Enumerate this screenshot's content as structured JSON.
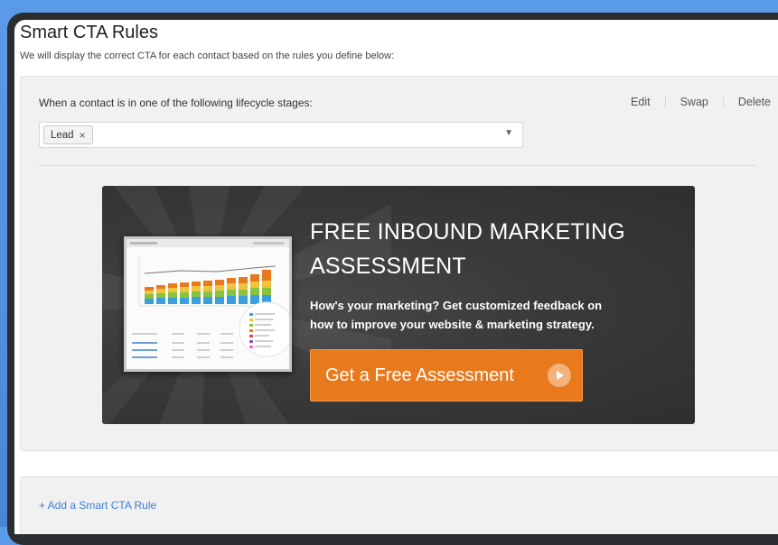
{
  "header": {
    "title": "Smart CTA Rules",
    "subtitle": "We will display the correct CTA for each contact based on the rules you define below:"
  },
  "rule": {
    "condition_label": "When a contact is in one of the following lifecycle stages:",
    "actions": {
      "edit": "Edit",
      "swap": "Swap",
      "delete": "Delete"
    },
    "selected_tags": [
      {
        "label": "Lead",
        "remove_symbol": "×"
      }
    ],
    "dropdown_icon": "caret-down-icon"
  },
  "cta": {
    "headline_line1": "FREE INBOUND MARKETING",
    "headline_line2": "ASSESSMENT",
    "description_line1": "How's your marketing? Get customized feedback on",
    "description_line2": "how to improve your website & marketing strategy.",
    "button_label": "Get a Free Assessment",
    "button_icon": "play-arrow-icon",
    "button_color": "#e8791c",
    "background_color": "#3a3a3a"
  },
  "footer": {
    "add_rule_label": "+ Add a Smart CTA Rule",
    "link_color": "#3f7fd0"
  }
}
